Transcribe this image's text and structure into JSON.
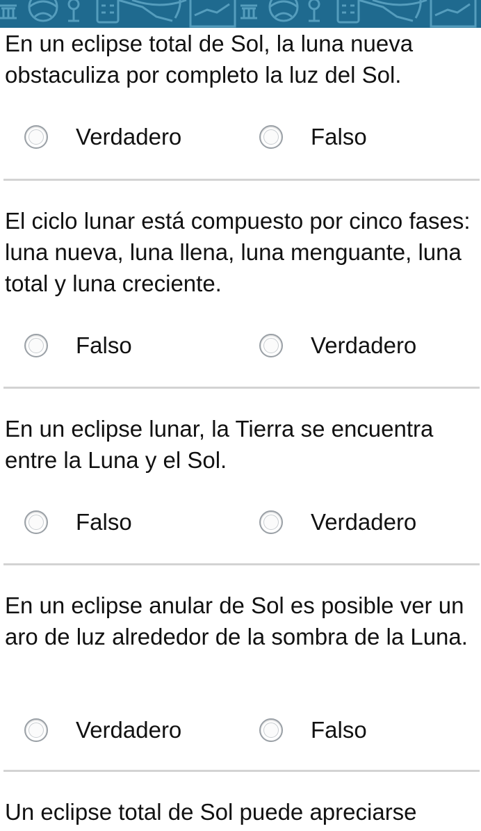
{
  "header": {
    "banner_icons": [
      "bank-icon",
      "globe-icon",
      "microscope-icon",
      "calculator-icon",
      "satellite-icon",
      "chart-icon"
    ]
  },
  "colors": {
    "banner": "#1f6a8f",
    "divider": "#d3d3d3",
    "text": "#111111"
  },
  "questions": [
    {
      "text": "En un eclipse total de Sol, la luna nueva obstaculiza por completo la luz del Sol.",
      "options": [
        "Verdadero",
        "Falso"
      ]
    },
    {
      "text": "El ciclo lunar está compuesto por cinco fases: luna nueva, luna llena, luna menguante, luna total y luna creciente.",
      "options": [
        "Falso",
        "Verdadero"
      ]
    },
    {
      "text": "En un eclipse lunar, la Tierra se encuentra entre la Luna y el Sol.",
      "options": [
        "Falso",
        "Verdadero"
      ]
    },
    {
      "text": "En un eclipse anular de Sol es posible ver un aro de luz alrededor de la sombra de la Luna.",
      "options": [
        "Verdadero",
        "Falso"
      ]
    },
    {
      "text": "Un eclipse total de Sol puede apreciarse"
    }
  ]
}
